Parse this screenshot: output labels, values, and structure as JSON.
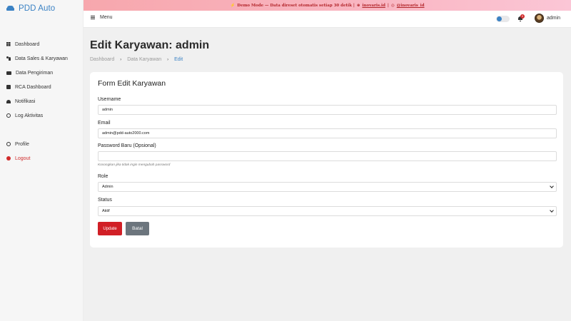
{
  "brand": {
    "name": "PDD Auto"
  },
  "sidebar": {
    "items": [
      {
        "label": "Dashboard",
        "icon": "grid-icon"
      },
      {
        "label": "Data Sales & Karyawan",
        "icon": "users-icon"
      },
      {
        "label": "Data Pengiriman",
        "icon": "truck-icon"
      },
      {
        "label": "RCA Dashboard",
        "icon": "document-icon"
      },
      {
        "label": "Notifikasi",
        "icon": "bell-icon"
      },
      {
        "label": "Log Aktivitas",
        "icon": "clock-icon"
      }
    ],
    "profile_label": "Profile",
    "logout_label": "Logout"
  },
  "banner": {
    "text": "Demo Mode — Data direset otomatis setiap 30 detik |",
    "link1": "inovaris.id",
    "divider": "|",
    "link2": "@inovaris_id"
  },
  "topbar": {
    "menu_label": "Menu",
    "notification_count": "0",
    "username": "admin",
    "toggle_on": true
  },
  "page": {
    "title": "Edit Karyawan: admin",
    "breadcrumb": [
      "Dashboard",
      "Data Karyawan",
      "Edit"
    ]
  },
  "form": {
    "title": "Form Edit Karyawan",
    "username_label": "Username",
    "username_value": "admin",
    "email_label": "Email",
    "email_value": "admin@pdd-auto2000.com",
    "password_label": "Password Baru (Opsional)",
    "password_value": "",
    "password_hint": "Kosongkan jika tidak ingin mengubah password",
    "role_label": "Role",
    "role_value": "Admin",
    "status_label": "Status",
    "status_value": "Aktif",
    "update_button": "Update",
    "cancel_button": "Batal"
  },
  "colors": {
    "brand": "#3b82c4",
    "danger": "#d11f26",
    "secondary": "#6c757d",
    "banner_text": "#b3262b"
  }
}
